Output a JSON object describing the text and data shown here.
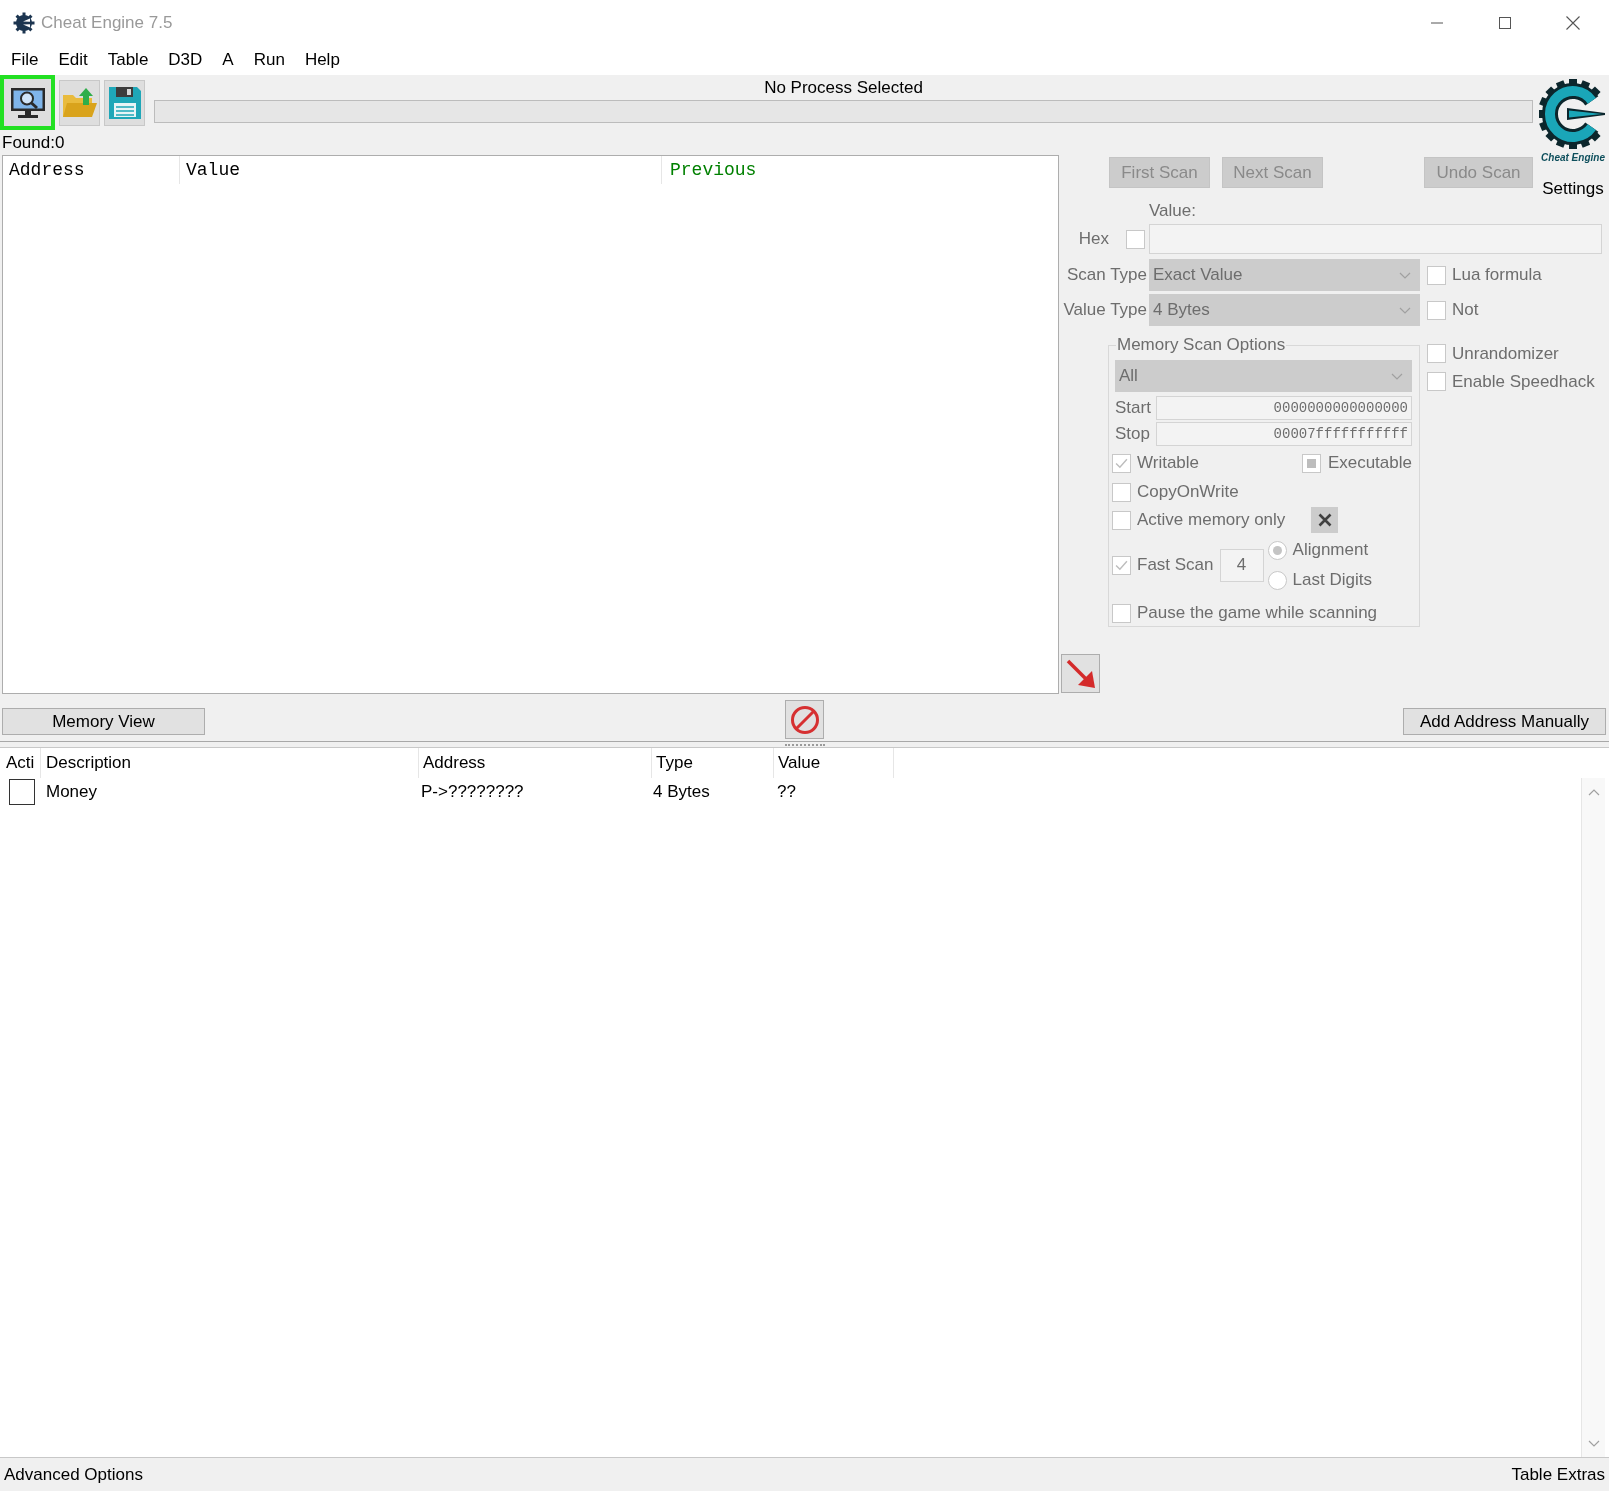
{
  "window": {
    "title": "Cheat Engine 7.5"
  },
  "menu": [
    "File",
    "Edit",
    "Table",
    "D3D",
    "A",
    "Run",
    "Help"
  ],
  "toolbar": {
    "buttons": [
      {
        "kind": "open-process",
        "highlighted": true
      },
      {
        "kind": "open-file",
        "highlighted": false
      },
      {
        "kind": "save",
        "highlighted": false
      }
    ],
    "process_label": "No Process Selected",
    "progress": {
      "level": 0
    }
  },
  "logo": {
    "caption": "Cheat Engine",
    "settings_label": "Settings"
  },
  "found_label": "Found:0",
  "results": {
    "columns": [
      {
        "label": "Address",
        "color": "#000000"
      },
      {
        "label": "Value",
        "color": "#000000"
      },
      {
        "label": "Previous",
        "color": "#008000"
      }
    ]
  },
  "scan": {
    "disabled": true,
    "buttons": [
      "First Scan",
      "Next Scan",
      "Undo Scan"
    ],
    "value_label": "Value:",
    "hex": {
      "label": "Hex",
      "checked": false
    },
    "scan_type": {
      "label": "Scan Type",
      "value": "Exact Value"
    },
    "value_type": {
      "label": "Value Type",
      "value": "4 Bytes"
    },
    "type_options": [
      {
        "label": "Lua formula",
        "checked": false
      },
      {
        "label": "Not",
        "checked": false
      }
    ],
    "extra_options": [
      {
        "label": "Unrandomizer",
        "checked": false
      },
      {
        "label": "Enable Speedhack",
        "checked": false
      }
    ],
    "memory": {
      "title": "Memory Scan Options",
      "region": "All",
      "start": {
        "label": "Start",
        "value": "0000000000000000"
      },
      "stop": {
        "label": "Stop",
        "value": "00007fffffffffff"
      },
      "writable": {
        "label": "Writable",
        "checked": true
      },
      "executable": {
        "label": "Executable",
        "indeterminate": true
      },
      "copy_on_write": {
        "label": "CopyOnWrite",
        "checked": false
      },
      "active_memory_only": {
        "label": "Active memory only",
        "checked": false
      },
      "fast_scan": {
        "label": "Fast Scan",
        "checked": true,
        "value": "4"
      },
      "fast_scan_modes": [
        {
          "label": "Alignment",
          "selected": true
        },
        {
          "label": "Last Digits",
          "selected": false
        }
      ],
      "pause": {
        "label": "Pause the game while scanning",
        "checked": false
      }
    }
  },
  "actions": {
    "memory_view": "Memory View",
    "add_address": "Add Address Manually"
  },
  "cheat_table": {
    "columns": [
      "Acti",
      "Description",
      "Address",
      "Type",
      "Value"
    ],
    "rows": [
      {
        "active": false,
        "description": "Money",
        "address": "P->????????",
        "type": "4 Bytes",
        "value": "??"
      }
    ]
  },
  "status_bar": {
    "left": "Advanced Options",
    "right": "Table Extras"
  }
}
